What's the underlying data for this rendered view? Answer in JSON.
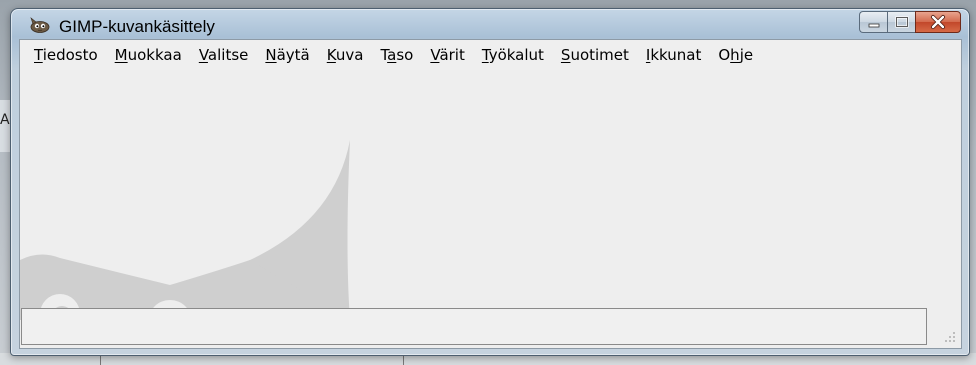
{
  "window": {
    "title": "GIMP-kuvankäsittely",
    "icon": "gimp-wilber-icon",
    "buttons": [
      "minimize",
      "maximize",
      "close"
    ]
  },
  "menubar": {
    "items": [
      {
        "pre": "",
        "key": "T",
        "post": "iedosto"
      },
      {
        "pre": "",
        "key": "M",
        "post": "uokkaa"
      },
      {
        "pre": "",
        "key": "V",
        "post": "alitse"
      },
      {
        "pre": "",
        "key": "N",
        "post": "äytä"
      },
      {
        "pre": "",
        "key": "K",
        "post": "uva"
      },
      {
        "pre": "T",
        "key": "a",
        "post": "so"
      },
      {
        "pre": "",
        "key": "V",
        "post": "ärit"
      },
      {
        "pre": "",
        "key": "T",
        "post": "yökalut"
      },
      {
        "pre": "",
        "key": "S",
        "post": "uotimet"
      },
      {
        "pre": "",
        "key": "I",
        "post": "kkunat"
      },
      {
        "pre": "O",
        "key": "h",
        "post": "je"
      }
    ]
  },
  "background": {
    "edge_letter": "A"
  },
  "colors": {
    "client_bg": "#eeeeee",
    "watermark": "#cfcfcf",
    "close_button": "#c2472a"
  }
}
